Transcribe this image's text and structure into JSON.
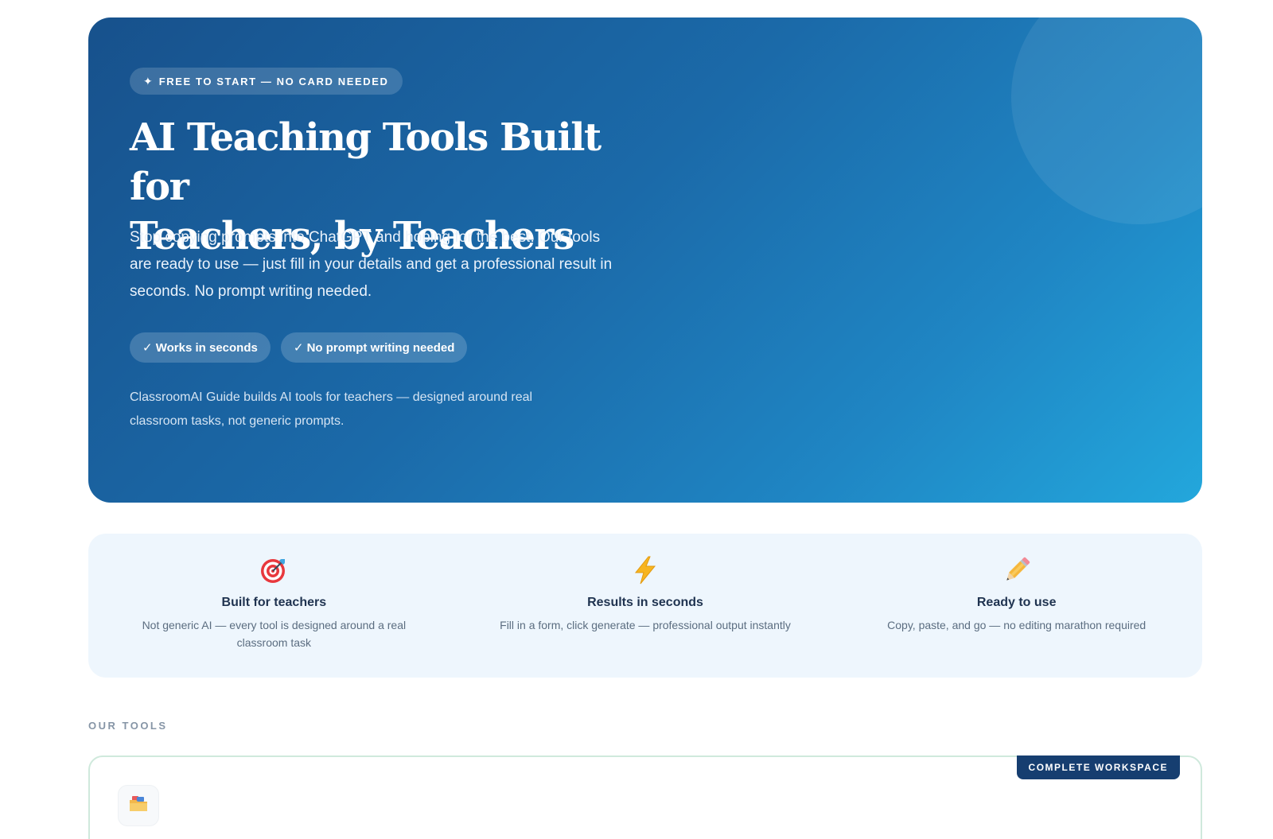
{
  "hero": {
    "badge_icon": "sparkle-icon",
    "badge_text": "FREE TO START — NO CARD NEEDED",
    "title_line1": "AI Teaching Tools Built for",
    "title_line2": "Teachers, by Teachers",
    "description": "Stop copying prompts into ChatGPT and hoping for the best. Our tools are ready to use — just fill in your details and get a professional result in seconds. No prompt writing needed.",
    "pills": [
      {
        "label": "✓ Works in seconds"
      },
      {
        "label": "✓ No prompt writing needed"
      }
    ],
    "note": "ClassroomAI Guide builds AI tools for teachers — designed around real classroom tasks, not generic prompts.",
    "gradient_start": "#17518c",
    "gradient_end": "#23a7dc"
  },
  "features": [
    {
      "icon": "target-icon",
      "title": "Built for teachers",
      "description": "Not generic AI — every tool is designed around a real classroom task"
    },
    {
      "icon": "lightning-icon",
      "title": "Results in seconds",
      "description": "Fill in a form, click generate — professional output instantly"
    },
    {
      "icon": "pencil-icon",
      "title": "Ready to use",
      "description": "Copy, paste, and go — no editing marathon required"
    }
  ],
  "tools": {
    "section_label": "OUR TOOLS",
    "card": {
      "tag": "COMPLETE WORKSPACE",
      "icon": "folder-icon"
    }
  },
  "colors": {
    "feature_bg": "#eef6fd",
    "tag_bg": "#163e70",
    "card_border": "#cfe9dc"
  }
}
